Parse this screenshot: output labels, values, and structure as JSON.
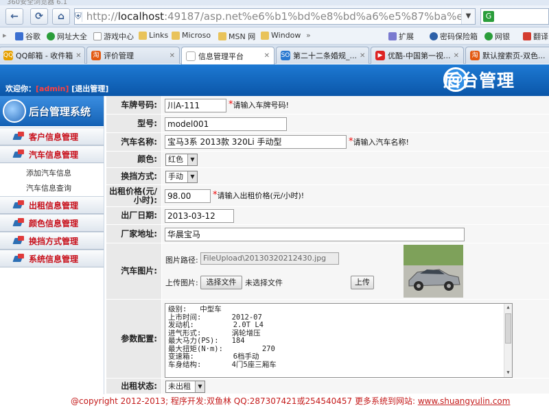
{
  "browser": {
    "title": "360安全浏览器 6.1",
    "url_prefix": "http://",
    "url_host": "localhost",
    "url_rest": ":49187/asp.net%e6%b1%bd%e8%bd%a6%e5%87%ba%e7%a7%9f",
    "search_icon": "G",
    "bookmarks": [
      "谷歌",
      "网址大全",
      "游戏中心",
      "Links",
      "Microso",
      "MSN 网",
      "Window",
      "»",
      "扩展",
      "密码保险箱",
      "网银",
      "翻译"
    ],
    "tabs": [
      {
        "label": "QQ邮箱 - 收件箱",
        "fav": "QQ",
        "color": "#e5a000"
      },
      {
        "label": "评价管理",
        "fav": "淘",
        "color": "#e35a12"
      },
      {
        "label": "信息管理平台",
        "fav": "",
        "color": "#ffffff"
      },
      {
        "label": "第二十二条婚规_...",
        "fav": "SO",
        "color": "#2a79d0"
      },
      {
        "label": "优酷-中国第一视...",
        "fav": "▶",
        "color": "#d22"
      },
      {
        "label": "默认搜索页-双色...",
        "fav": "淘",
        "color": "#e35a12"
      }
    ]
  },
  "header": {
    "welcome_label": "欢迎你：",
    "user": "[admin]",
    "logout": "[退出管理]",
    "brand_text": "后台管理"
  },
  "sidebar": {
    "logo_text": "后台管理系统",
    "menu": [
      {
        "label": "客户信息管理"
      },
      {
        "label": "汽车信息管理",
        "children": [
          "添加汽车信息",
          "汽车信息查询"
        ]
      },
      {
        "label": "出租信息管理"
      },
      {
        "label": "颜色信息管理"
      },
      {
        "label": "换挡方式管理"
      },
      {
        "label": "系统信息管理"
      }
    ]
  },
  "form": {
    "plate": {
      "label": "车牌号码:",
      "value": "川A-111",
      "hint": "请输入车牌号码!"
    },
    "model": {
      "label": "型号:",
      "value": "model001"
    },
    "name": {
      "label": "汽车名称:",
      "value": "宝马3系 2013款 320Li 手动型",
      "hint": "请输入汽车名称!"
    },
    "color": {
      "label": "颜色:",
      "value": "红色"
    },
    "shift": {
      "label": "换挡方式:",
      "value": "手动"
    },
    "price": {
      "label": "出租价格(元/小时):",
      "value": "98.00",
      "hint": "请输入出租价格(元/小时)!"
    },
    "date": {
      "label": "出厂日期:",
      "value": "2013-03-12"
    },
    "address": {
      "label": "厂家地址:",
      "value": "华晨宝马"
    },
    "image": {
      "label": "汽车图片:",
      "path_label": "图片路径:",
      "path_value": "FileUpload\\20130320212430.jpg",
      "upload_label": "上传图片:",
      "choose_button": "选择文件",
      "no_file": "未选择文件",
      "upload_button": "上传"
    },
    "config": {
      "label": "参数配置:",
      "lines": [
        "级别:   中型车",
        "上市时间:       2012-07",
        "发动机:         2.0T L4",
        "进气形式:       涡轮增压",
        "最大马力(PS):   184",
        "最大扭矩(N·m):         270",
        "变速箱:         6档手动",
        "车身结构:       4门5座三厢车"
      ]
    },
    "status": {
      "label": "出租状态:",
      "value": "未出租"
    }
  },
  "footer": {
    "text": "@copyright 2012-2013; 程序开发:双鱼林  QQ:287307421或254540457  更多系统到网站: ",
    "link": "www.shuangyulin.com"
  }
}
